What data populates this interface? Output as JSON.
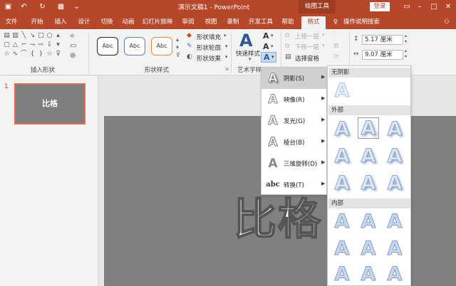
{
  "titlebar": {
    "doc_title": "演示文稿1 - PowerPoint",
    "context_tools": "绘图工具",
    "login": "登录"
  },
  "tabs": [
    "文件",
    "开始",
    "插入",
    "设计",
    "切换",
    "动画",
    "幻灯片放映",
    "审阅",
    "视图",
    "录制",
    "开发工具",
    "帮助",
    "格式",
    "操作说明搜索"
  ],
  "ribbon": {
    "insert_shapes_label": "插入形状",
    "shape_styles_label": "形状样式",
    "wordart_label": "艺术字样",
    "style_sample": "Abc",
    "shape_fill": "形状填充",
    "shape_outline": "形状轮廓",
    "shape_effects": "形状效果",
    "quick_styles": "快速样式",
    "bring_forward": "上移一层",
    "send_backward": "下移一层",
    "selection_pane": "选择窗格",
    "height": "5.17 厘米",
    "width": "9.07 厘米"
  },
  "thumbnail": {
    "slide_number": "1",
    "slide_text": "比格"
  },
  "slide": {
    "text": "比格"
  },
  "menu": {
    "items": [
      {
        "label": "阴影(S)",
        "glyph": "A"
      },
      {
        "label": "映像(R)",
        "glyph": "A"
      },
      {
        "label": "发光(G)",
        "glyph": "A"
      },
      {
        "label": "棱台(B)",
        "glyph": "A"
      },
      {
        "label": "三维旋转(D)",
        "glyph": "A"
      },
      {
        "label": "转换(T)",
        "glyph": "abc"
      }
    ]
  },
  "submenu": {
    "no_shadow": "无阴影",
    "outer": "外部",
    "inner": "内部",
    "glyph": "A"
  },
  "colors": {
    "accent": "#b7472a",
    "slide_bg": "#808080"
  }
}
